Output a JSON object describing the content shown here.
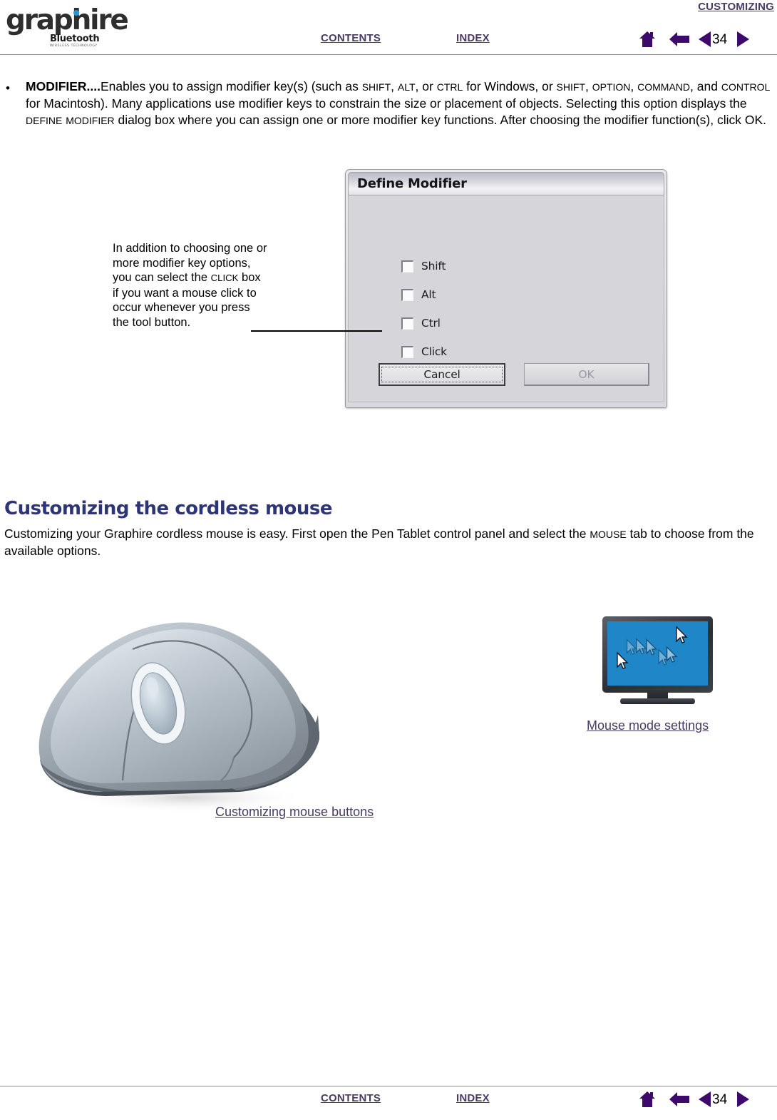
{
  "header": {
    "section_label": "CUSTOMIZING",
    "contents_label": "CONTENTS",
    "index_label": "INDEX",
    "page_number": "34",
    "icons": [
      "home-icon",
      "back-arrow-icon",
      "previous-page-icon",
      "next-page-icon"
    ]
  },
  "footer": {
    "contents_label": "CONTENTS",
    "index_label": "INDEX",
    "page_number": "34"
  },
  "logo": {
    "word": "graphire",
    "bluetooth": "Bluetooth",
    "subtitle": "WIRELESS TECHNOLOGY"
  },
  "bullet": {
    "marker": "•",
    "term": "MODIFIER....",
    "body_1": "Enables you to assign modifier key(s) (such as ",
    "k_shift": "SHIFT",
    "sep_1": ", ",
    "k_alt": "ALT",
    "sep_2": ", or ",
    "k_ctrl": "CTRL",
    "body_2": " for Windows, or ",
    "k_shift2": "SHIFT",
    "sep_3": ", ",
    "k_option": "OPTION",
    "sep_4": ", ",
    "k_command": "COMMAND",
    "sep_5": ", and ",
    "k_control": "CONTROL",
    "body_3": " for Macintosh).  Many applications use modifier keys to constrain the size or placement of objects.  Selecting this option displays the ",
    "dlg_name_a": "DEFINE",
    "dlg_space": " ",
    "dlg_name_b": "MODIFIER",
    "body_4": " dialog box where you can assign one or more modifier key functions.  After choosing the modifier function(s), click OK."
  },
  "dialog": {
    "title": "Define Modifier",
    "checkboxes": [
      {
        "label": "Shift",
        "checked": false
      },
      {
        "label": "Alt",
        "checked": false
      },
      {
        "label": "Ctrl",
        "checked": false
      },
      {
        "label": "Click",
        "checked": false
      }
    ],
    "cancel_label": "Cancel",
    "ok_label": "OK"
  },
  "callout": {
    "line_1": "In addition to choosing one or",
    "line_2": "more modifier key options,",
    "line_3a": "you can select the ",
    "line_3b": "CLICK",
    "line_3c": " box",
    "line_4": "if you want a mouse click to",
    "line_5": "occur whenever you press",
    "line_6": "the tool button."
  },
  "section": {
    "heading": "Customizing the cordless mouse",
    "body_1": "Customizing your Graphire cordless mouse is easy.  First open the Pen Tablet control panel and select the ",
    "tab_name": "MOUSE",
    "body_2": " tab to choose from the available options."
  },
  "figures": {
    "mouse_link": "Customizing mouse buttons",
    "monitor_link": "Mouse mode settings"
  },
  "colors": {
    "link_purple": "#4a3a63",
    "nav_purple": "#3d0a6b",
    "heading_blue": "#2e3577",
    "screen_blue": "#1f86c8"
  }
}
